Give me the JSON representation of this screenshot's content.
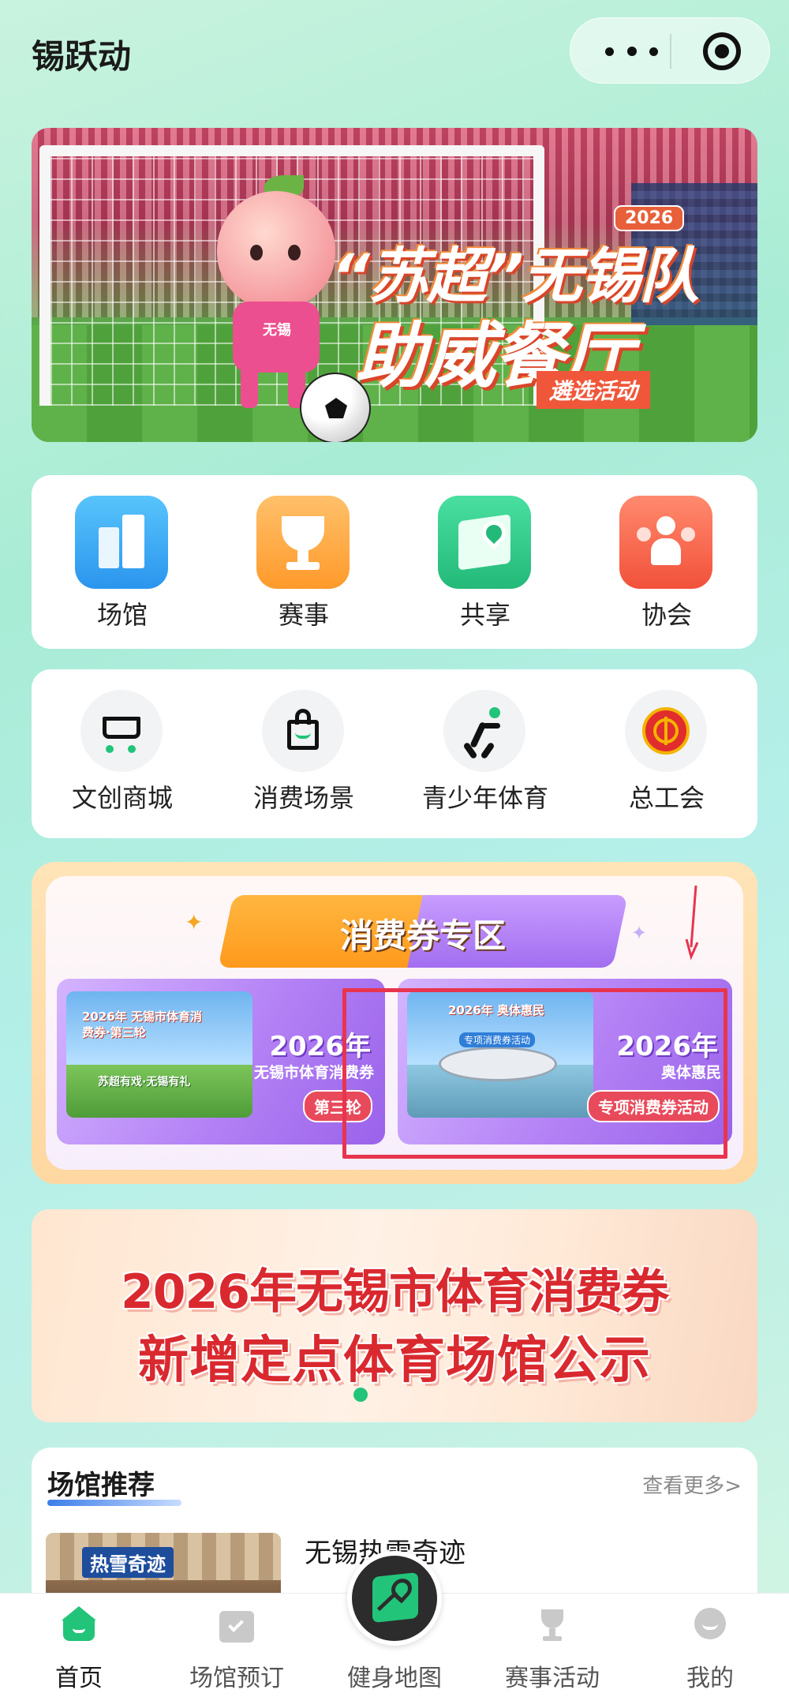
{
  "header": {
    "app_title": "锡跃动",
    "more_icon": "more-dots-icon",
    "close_icon": "record-target-icon"
  },
  "banner": {
    "year_badge": "2026",
    "line1": "“苏超”无锡队",
    "line2": "助威餐厅",
    "subtitle": "遴选活动",
    "mascot_jersey": "无锡",
    "dots": 4,
    "active_dot": 1
  },
  "main_nav": {
    "items": [
      {
        "label": "场馆",
        "icon": "stadium-buildings-icon",
        "color": "#3aa6f2"
      },
      {
        "label": "赛事",
        "icon": "trophy-icon",
        "color": "#ffa23a"
      },
      {
        "label": "共享",
        "icon": "map-pin-icon",
        "color": "#2fcb87"
      },
      {
        "label": "协会",
        "icon": "people-group-icon",
        "color": "#f65b46"
      }
    ]
  },
  "sub_nav": {
    "items": [
      {
        "label": "文创商城",
        "icon": "shopping-cart-icon"
      },
      {
        "label": "消费场景",
        "icon": "shopping-bag-icon"
      },
      {
        "label": "青少年体育",
        "icon": "running-person-icon"
      },
      {
        "label": "总工会",
        "icon": "trade-union-emblem-icon"
      }
    ]
  },
  "voucher_zone": {
    "title": "消费券专区",
    "cards": [
      {
        "scene_caption": "2026年 无锡市体育消费券·第三轮",
        "scene_sub": "苏超有戏·无锡有礼",
        "year": "2026年",
        "desc": "无锡市体育消费券",
        "pill": "第三轮"
      },
      {
        "scene_caption": "2026年 奥体惠民",
        "scene_sub": "专项消费券活动",
        "year": "2026年",
        "desc": "奥体惠民",
        "pill": "专项消费券活动"
      }
    ]
  },
  "notice": {
    "line1": "2026年无锡市体育消费券",
    "line2": "新增定点体育场馆公示"
  },
  "recommend": {
    "title": "场馆推荐",
    "more": "查看更多>",
    "items": [
      {
        "name": "无锡热雪奇迹",
        "thumb_sign": "热雪奇迹"
      }
    ]
  },
  "tabbar": {
    "items": [
      {
        "label": "首页",
        "icon": "home-icon",
        "active": true
      },
      {
        "label": "场馆预订",
        "icon": "calendar-check-icon",
        "active": false
      },
      {
        "label": "健身地图",
        "icon": "fitness-map-icon",
        "active": false
      },
      {
        "label": "赛事活动",
        "icon": "trophy-icon",
        "active": false
      },
      {
        "label": "我的",
        "icon": "user-avatar-icon",
        "active": false
      }
    ]
  }
}
